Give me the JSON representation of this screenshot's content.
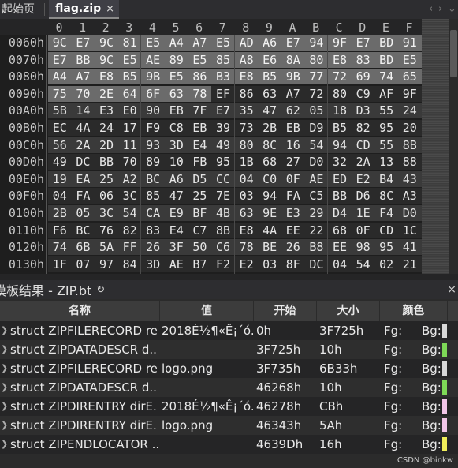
{
  "tabs": {
    "start_label": "起始页",
    "active_label": "flag.zip",
    "close_glyph": "×",
    "nav_prev": "‹",
    "nav_next": "›",
    "nav_menu": "⌄"
  },
  "hex": {
    "col_headers": [
      "0",
      "1",
      "2",
      "3",
      "4",
      "5",
      "6",
      "7",
      "8",
      "9",
      "A",
      "B",
      "C",
      "D",
      "E",
      "F"
    ],
    "rows": [
      {
        "addr": "0060h",
        "bytes": [
          "9C",
          "E7",
          "9C",
          "81",
          "E5",
          "A4",
          "A7",
          "E5",
          "AD",
          "A6",
          "E7",
          "94",
          "9F",
          "E7",
          "BD",
          "91"
        ],
        "selected": [
          1,
          1,
          1,
          1,
          1,
          1,
          1,
          1,
          1,
          1,
          1,
          1,
          1,
          1,
          1,
          1
        ]
      },
      {
        "addr": "0070h",
        "bytes": [
          "E7",
          "BB",
          "9C",
          "E5",
          "AE",
          "89",
          "E5",
          "85",
          "A8",
          "E6",
          "8A",
          "80",
          "E8",
          "83",
          "BD",
          "E5"
        ],
        "selected": [
          1,
          1,
          1,
          1,
          1,
          1,
          1,
          1,
          1,
          1,
          1,
          1,
          1,
          1,
          1,
          1
        ]
      },
      {
        "addr": "0080h",
        "bytes": [
          "A4",
          "A7",
          "E8",
          "B5",
          "9B",
          "E5",
          "86",
          "B3",
          "E8",
          "B5",
          "9B",
          "77",
          "72",
          "69",
          "74",
          "65"
        ],
        "selected": [
          1,
          1,
          1,
          1,
          1,
          1,
          1,
          1,
          1,
          1,
          1,
          1,
          1,
          1,
          1,
          1
        ]
      },
      {
        "addr": "0090h",
        "bytes": [
          "75",
          "70",
          "2E",
          "64",
          "6F",
          "63",
          "78",
          "EF",
          "86",
          "63",
          "A7",
          "72",
          "80",
          "C9",
          "AF",
          "9F"
        ],
        "selected": [
          1,
          1,
          1,
          1,
          1,
          1,
          1,
          0,
          0,
          0,
          0,
          0,
          0,
          0,
          0,
          0
        ]
      },
      {
        "addr": "00A0h",
        "bytes": [
          "5B",
          "14",
          "E3",
          "E0",
          "90",
          "EB",
          "7F",
          "E7",
          "35",
          "47",
          "62",
          "05",
          "18",
          "D3",
          "55",
          "24"
        ],
        "selected": [
          0,
          0,
          0,
          0,
          0,
          0,
          0,
          0,
          0,
          0,
          0,
          0,
          0,
          0,
          0,
          0
        ]
      },
      {
        "addr": "00B0h",
        "bytes": [
          "EC",
          "4A",
          "24",
          "17",
          "F9",
          "C8",
          "EB",
          "39",
          "73",
          "2B",
          "EB",
          "D9",
          "B5",
          "82",
          "95",
          "20"
        ],
        "selected": [
          0,
          0,
          0,
          0,
          0,
          0,
          0,
          0,
          0,
          0,
          0,
          0,
          0,
          0,
          0,
          0
        ]
      },
      {
        "addr": "00C0h",
        "bytes": [
          "56",
          "2A",
          "2D",
          "11",
          "93",
          "3D",
          "E4",
          "49",
          "80",
          "8C",
          "16",
          "54",
          "94",
          "CD",
          "55",
          "8B"
        ],
        "selected": [
          0,
          0,
          0,
          0,
          0,
          0,
          0,
          0,
          0,
          0,
          0,
          0,
          0,
          0,
          0,
          0
        ]
      },
      {
        "addr": "00D0h",
        "bytes": [
          "49",
          "DC",
          "BB",
          "70",
          "89",
          "10",
          "FB",
          "95",
          "1B",
          "68",
          "27",
          "D0",
          "32",
          "2A",
          "13",
          "88"
        ],
        "selected": [
          0,
          0,
          0,
          0,
          0,
          0,
          0,
          0,
          0,
          0,
          0,
          0,
          0,
          0,
          0,
          0
        ]
      },
      {
        "addr": "00E0h",
        "bytes": [
          "19",
          "EA",
          "25",
          "A2",
          "BC",
          "A6",
          "D5",
          "CC",
          "04",
          "C0",
          "0F",
          "AE",
          "ED",
          "E2",
          "B4",
          "43"
        ],
        "selected": [
          0,
          0,
          0,
          0,
          0,
          0,
          0,
          0,
          0,
          0,
          0,
          0,
          0,
          0,
          0,
          0
        ]
      },
      {
        "addr": "00F0h",
        "bytes": [
          "04",
          "FA",
          "06",
          "3C",
          "85",
          "47",
          "25",
          "7E",
          "03",
          "94",
          "FA",
          "C5",
          "BB",
          "D6",
          "8C",
          "A3"
        ],
        "selected": [
          0,
          0,
          0,
          0,
          0,
          0,
          0,
          0,
          0,
          0,
          0,
          0,
          0,
          0,
          0,
          0
        ]
      },
      {
        "addr": "0100h",
        "bytes": [
          "2B",
          "05",
          "3C",
          "54",
          "CA",
          "E9",
          "BF",
          "4B",
          "63",
          "9E",
          "E3",
          "29",
          "D4",
          "1E",
          "F4",
          "D0"
        ],
        "selected": [
          0,
          0,
          0,
          0,
          0,
          0,
          0,
          0,
          0,
          0,
          0,
          0,
          0,
          0,
          0,
          0
        ]
      },
      {
        "addr": "0110h",
        "bytes": [
          "F6",
          "BC",
          "76",
          "82",
          "83",
          "E4",
          "C7",
          "8B",
          "E8",
          "4A",
          "EE",
          "22",
          "68",
          "0F",
          "CD",
          "1C"
        ],
        "selected": [
          0,
          0,
          0,
          0,
          0,
          0,
          0,
          0,
          0,
          0,
          0,
          0,
          0,
          0,
          0,
          0
        ]
      },
      {
        "addr": "0120h",
        "bytes": [
          "74",
          "6B",
          "5A",
          "FF",
          "26",
          "3F",
          "50",
          "C6",
          "78",
          "BE",
          "26",
          "B8",
          "EE",
          "98",
          "95",
          "41"
        ],
        "selected": [
          0,
          0,
          0,
          0,
          0,
          0,
          0,
          0,
          0,
          0,
          0,
          0,
          0,
          0,
          0,
          0
        ]
      },
      {
        "addr": "0130h",
        "bytes": [
          "1F",
          "07",
          "97",
          "84",
          "3D",
          "AE",
          "B7",
          "F2",
          "E2",
          "03",
          "8F",
          "DC",
          "04",
          "54",
          "02",
          "21"
        ],
        "selected": [
          0,
          0,
          0,
          0,
          0,
          0,
          0,
          0,
          0,
          0,
          0,
          0,
          0,
          0,
          0,
          0
        ]
      }
    ]
  },
  "panel": {
    "title": "模板结果 - ZIP.bt",
    "refresh_glyph": "↻",
    "close_glyph": "×"
  },
  "table": {
    "headers": {
      "name": "名称",
      "value": "值",
      "start": "开始",
      "size": "大小",
      "color": "颜色"
    },
    "rows": [
      {
        "name": "struct ZIPFILERECORD re...",
        "value": "2018É½¶«Ê¡´ó...",
        "start": "0h",
        "size": "3F725h",
        "fg": "Fg:",
        "bg": "Bg:",
        "swatch": "#d8d8d8"
      },
      {
        "name": "struct ZIPDATADESCR d...",
        "value": "",
        "start": "3F725h",
        "size": "10h",
        "fg": "Fg:",
        "bg": "Bg:",
        "swatch": "#7ed957"
      },
      {
        "name": "struct ZIPFILERECORD re...",
        "value": "logo.png",
        "start": "3F735h",
        "size": "6B33h",
        "fg": "Fg:",
        "bg": "Bg:",
        "swatch": "#d8d8d8"
      },
      {
        "name": "struct ZIPDATADESCR d...",
        "value": "",
        "start": "46268h",
        "size": "10h",
        "fg": "Fg:",
        "bg": "Bg:",
        "swatch": "#7ed957"
      },
      {
        "name": "struct ZIPDIRENTRY dirE...",
        "value": "2018É½¶«Ê¡´ó...",
        "start": "46278h",
        "size": "CBh",
        "fg": "Fg:",
        "bg": "Bg:",
        "swatch": "#f2c6e8"
      },
      {
        "name": "struct ZIPDIRENTRY dirE...",
        "value": "logo.png",
        "start": "46343h",
        "size": "5Ah",
        "fg": "Fg:",
        "bg": "Bg:",
        "swatch": "#f2c6e8"
      },
      {
        "name": "struct ZIPENDLOCATOR ...",
        "value": "",
        "start": "4639Dh",
        "size": "16h",
        "fg": "Fg:",
        "bg": "Bg:",
        "swatch": "#f0ee5a"
      }
    ]
  },
  "watermark": "CSDN @binkw"
}
